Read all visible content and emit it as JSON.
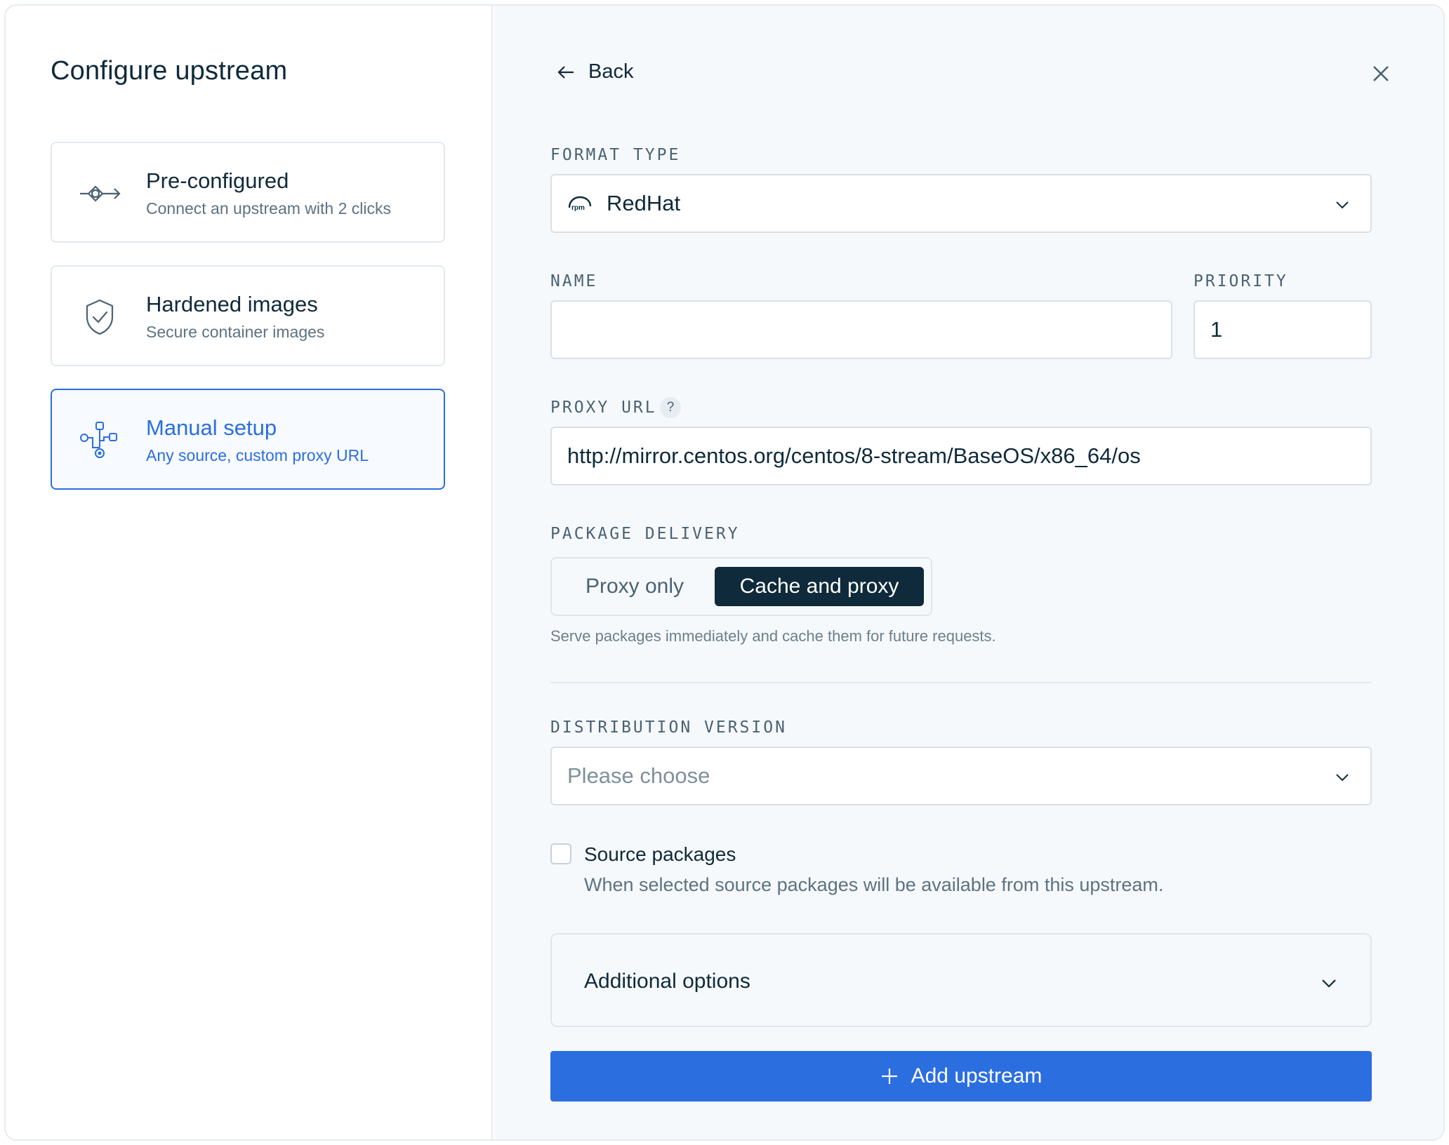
{
  "left": {
    "title": "Configure upstream",
    "options": [
      {
        "title": "Pre-configured",
        "subtitle": "Connect an upstream with 2 clicks",
        "icon": "connector-icon",
        "active": false
      },
      {
        "title": "Hardened images",
        "subtitle": "Secure container images",
        "icon": "shield-check-icon",
        "active": false
      },
      {
        "title": "Manual setup",
        "subtitle": "Any source, custom proxy URL",
        "icon": "network-nodes-icon",
        "active": true
      }
    ]
  },
  "header": {
    "back_label": "Back"
  },
  "form": {
    "format_type": {
      "label": "FORMAT TYPE",
      "value": "RedHat",
      "icon": "rpm-icon"
    },
    "name": {
      "label": "NAME",
      "value": ""
    },
    "priority": {
      "label": "PRIORITY",
      "value": "1"
    },
    "proxy_url": {
      "label": "PROXY URL",
      "help": "?",
      "value": "http://mirror.centos.org/centos/8-stream/BaseOS/x86_64/os"
    },
    "package_delivery": {
      "label": "PACKAGE DELIVERY",
      "options": [
        "Proxy only",
        "Cache and proxy"
      ],
      "selected": "Cache and proxy",
      "helper": "Serve packages immediately and cache them for future requests."
    },
    "distribution_version": {
      "label": "DISTRIBUTION VERSION",
      "placeholder": "Please choose"
    },
    "source_packages": {
      "label": "Source packages",
      "description": "When selected source packages will be available from this upstream.",
      "checked": false
    },
    "additional_options": {
      "label": "Additional options"
    },
    "submit": {
      "label": "Add upstream"
    }
  },
  "colors": {
    "accent": "#2b6ee0",
    "dark": "#0f2a3a",
    "panel_bg": "#f6f9fc"
  }
}
